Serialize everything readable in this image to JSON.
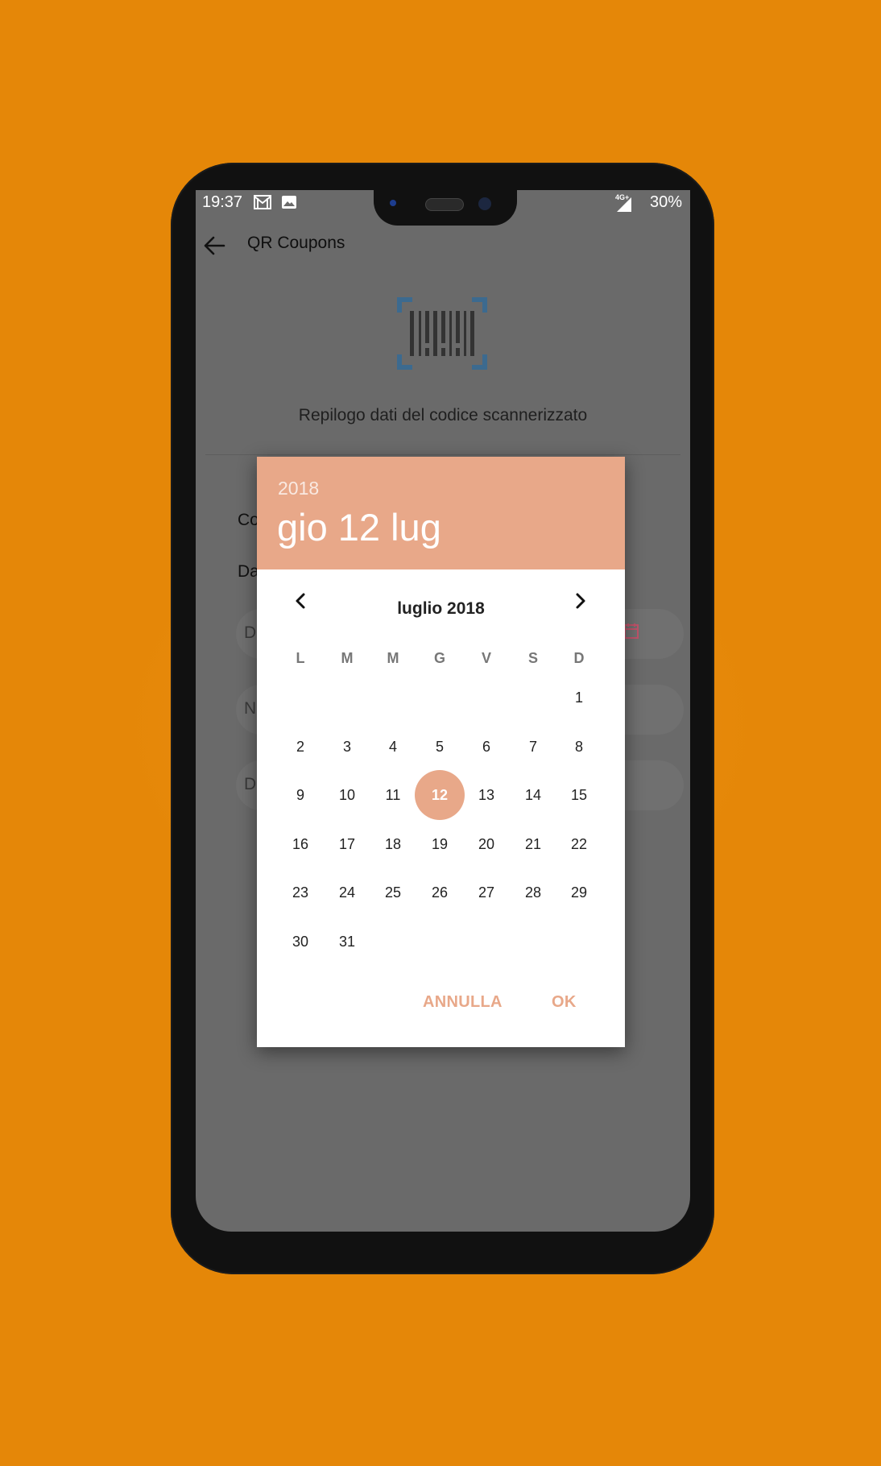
{
  "status_bar": {
    "time": "19:37",
    "network": "4G+",
    "battery": "30%"
  },
  "app_bar": {
    "title": "QR Coupons"
  },
  "summary": {
    "text": "Repilogo dati del codice scannerizzato"
  },
  "background_form": {
    "labels": [
      "Co",
      "Da"
    ],
    "fields": [
      "D",
      "N",
      "D"
    ]
  },
  "date_picker": {
    "year": "2018",
    "selected_date": "gio 12 lug",
    "month_title": "luglio 2018",
    "weekdays": [
      "L",
      "M",
      "M",
      "G",
      "V",
      "S",
      "D"
    ],
    "first_weekday_index": 6,
    "days_in_month": 31,
    "selected_day": 12,
    "cancel_label": "ANNULLA",
    "ok_label": "OK"
  },
  "colors": {
    "background": "#e58708",
    "accent": "#e8a889",
    "barcode_frame": "#3c6a8f",
    "calendar_icon": "#c0536a"
  },
  "icons": [
    "arrow-back-icon",
    "barcode-scan-icon",
    "chevron-left-icon",
    "chevron-right-icon",
    "calendar-icon",
    "gmail-icon",
    "image-icon",
    "signal-icon"
  ]
}
